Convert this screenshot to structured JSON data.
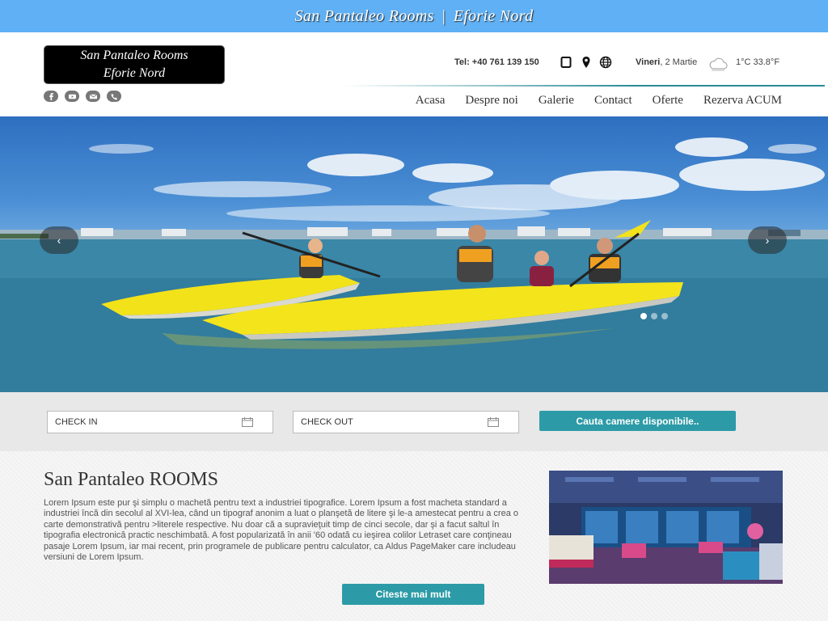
{
  "topbar": {
    "left": "San Pantaleo Rooms",
    "separator": "|",
    "right": "Eforie Nord"
  },
  "logo": {
    "line1": "San Pantaleo Rooms",
    "line2": "Eforie Nord"
  },
  "social": [
    "facebook-icon",
    "youtube-icon",
    "mail-icon",
    "phone-icon"
  ],
  "header": {
    "phone": "Tel: +40 761 139 150",
    "day": "Vineri",
    "date": ", 2 Martie",
    "temperature": "1°C  33.8°F",
    "icons": [
      "tablet-icon",
      "location-pin-icon",
      "globe-icon",
      "cloud-icon"
    ]
  },
  "nav": {
    "items": [
      "Acasa",
      "Despre noi",
      "Galerie",
      "Contact",
      "Oferte",
      "Rezerva ACUM"
    ]
  },
  "hero": {
    "prev": "‹",
    "next": "›",
    "slides": 3,
    "active_slide": 1
  },
  "search": {
    "check_in": "CHECK IN",
    "check_out": "CHECK OUT",
    "button": "Cauta camere disponibile.."
  },
  "content": {
    "title": "San Pantaleo ROOMS",
    "body": "Lorem Ipsum este pur şi simplu o machetă pentru text a industriei tipografice. Lorem Ipsum a fost macheta standard a industriei încă din secolul al XVI-lea, când un tipograf anonim a luat o planşetă de litere şi le-a amestecat pentru a crea o carte demonstrativă pentru >literele respective. Nu doar că a supravieţuit timp de cinci secole, dar şi a facut saltul în tipografia electronică practic neschimbată. A fost popularizată în anii '60 odată cu ieşirea colilor Letraset care conţineau pasaje Lorem Ipsum, iar mai recent, prin programele de publicare pentru calculator, ca Aldus PageMaker care includeau versiuni de Lorem Ipsum.",
    "button": "Citeste mai mult"
  },
  "colors": {
    "topbar": "#5fb0f5",
    "accent": "#2c9ba7",
    "logo_bg": "#000000"
  }
}
